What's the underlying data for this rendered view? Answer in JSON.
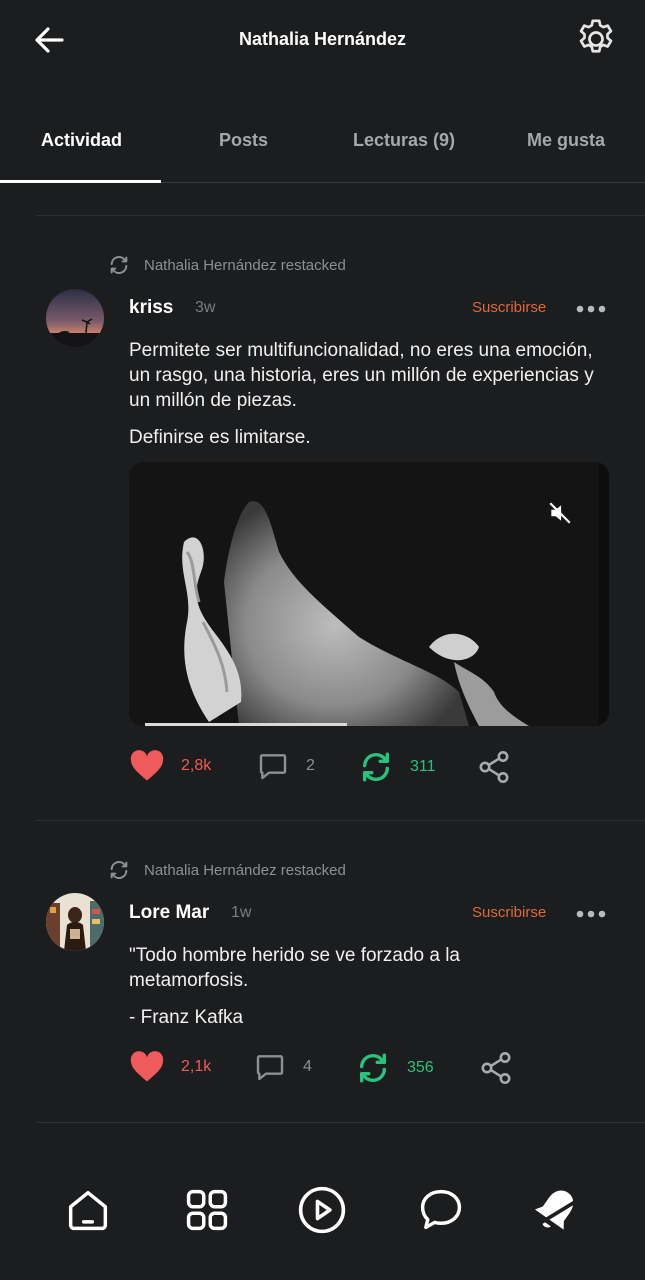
{
  "header": {
    "title": "Nathalia Hernández",
    "back_icon": "arrow-left-icon",
    "settings_icon": "gear-icon"
  },
  "tabs": [
    {
      "label": "Actividad",
      "active": true
    },
    {
      "label": "Posts",
      "active": false
    },
    {
      "label": "Lecturas (9)",
      "active": false
    },
    {
      "label": "Me gusta",
      "active": false
    }
  ],
  "posts": [
    {
      "restack_text": "Nathalia Hernández restacked",
      "author": "kriss",
      "time": "3w",
      "subscribe_label": "Suscribirse",
      "paragraphs": [
        "Permitete ser multifuncionalidad, no eres una emoción, un rasgo, una historia, eres un millón de experiencias y un millón de piezas.",
        "Definirse es limitarse."
      ],
      "has_video": true,
      "video_progress": 0.45,
      "likes": "2,8k",
      "comments": "2",
      "restacks": "311"
    },
    {
      "restack_text": "Nathalia Hernández restacked",
      "author": "Lore Mar",
      "time": "1w",
      "subscribe_label": "Suscribirse",
      "paragraphs": [
        "\"Todo hombre herido se ve forzado a la metamorfosis.",
        "- Franz Kafka"
      ],
      "likes": "2,1k",
      "comments": "4",
      "restacks": "356"
    }
  ],
  "colors": {
    "accent": "#e0683a",
    "like": "#ef5a5a",
    "restack": "#27c27c",
    "background": "#1c1d1f"
  },
  "bottom_nav": [
    "home-icon",
    "grid-icon",
    "play-icon",
    "chat-icon",
    "bell-icon"
  ]
}
